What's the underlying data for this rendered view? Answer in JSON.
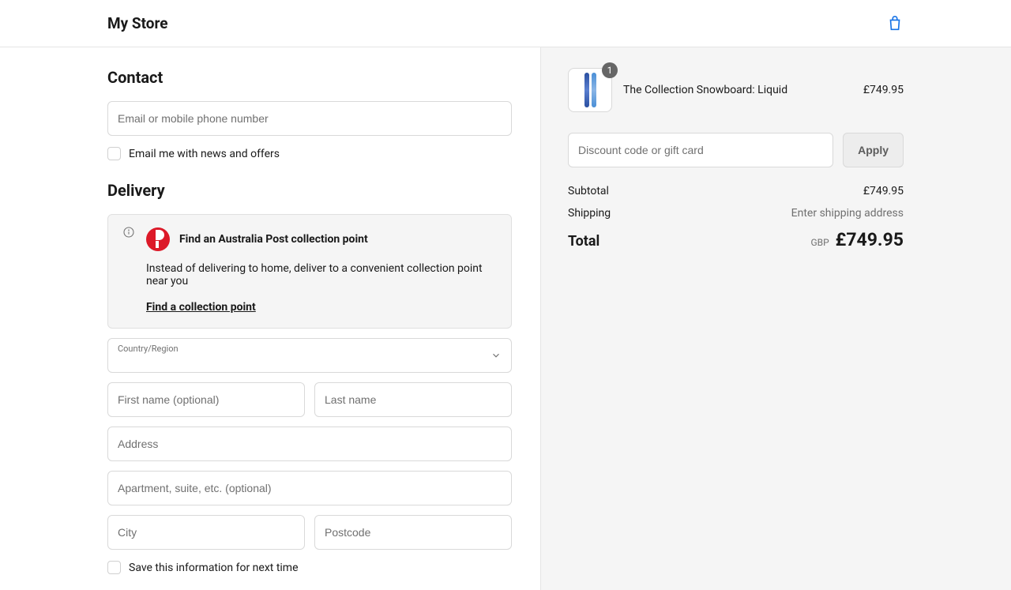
{
  "header": {
    "store_name": "My Store"
  },
  "contact": {
    "heading": "Contact",
    "email_placeholder": "Email or mobile phone number",
    "news_label": "Email me with news and offers"
  },
  "delivery": {
    "heading": "Delivery",
    "ap_title": "Find an Australia Post collection point",
    "ap_desc": "Instead of delivering to home, deliver to a convenient collection point near you",
    "ap_link": "Find a collection point",
    "country_label": "Country/Region",
    "first_name_ph": "First name (optional)",
    "last_name_ph": "Last name",
    "address_ph": "Address",
    "apartment_ph": "Apartment, suite, etc. (optional)",
    "city_ph": "City",
    "postcode_ph": "Postcode",
    "save_info_label": "Save this information for next time"
  },
  "summary": {
    "product_name": "The Collection Snowboard: Liquid",
    "product_price": "£749.95",
    "product_qty": "1",
    "discount_ph": "Discount code or gift card",
    "apply_label": "Apply",
    "subtotal_label": "Subtotal",
    "subtotal_value": "£749.95",
    "shipping_label": "Shipping",
    "shipping_value": "Enter shipping address",
    "total_label": "Total",
    "currency": "GBP",
    "total_value": "£749.95"
  }
}
